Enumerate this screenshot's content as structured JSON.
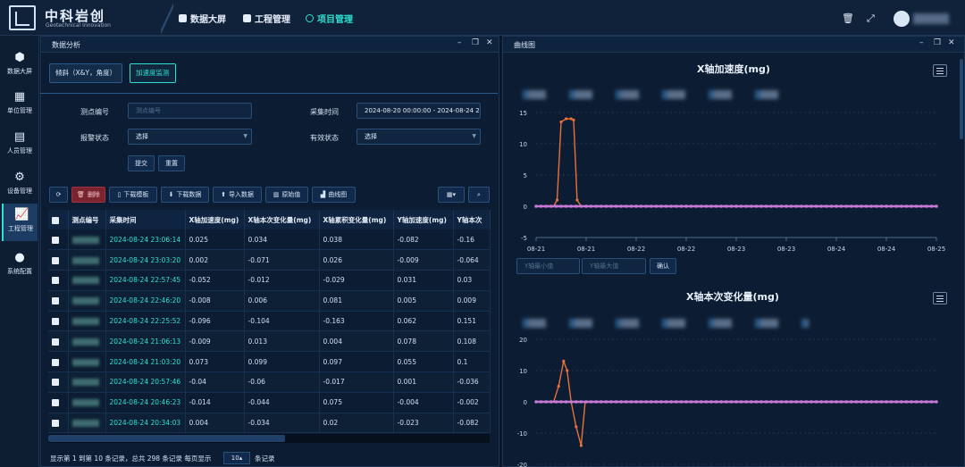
{
  "app": {
    "title": "中科岩创",
    "subtitle": "Geotechnical Innovation"
  },
  "top_nav": [
    {
      "label": "数据大屏",
      "icon": "cube-icon"
    },
    {
      "label": "工程管理",
      "icon": "edit-icon"
    },
    {
      "label": "项目管理",
      "icon": "circle-icon",
      "active": true
    }
  ],
  "top_icons": [
    "trash-icon",
    "fullscreen-icon"
  ],
  "sidebar": [
    {
      "label": "数据大屏",
      "icon": "cube-icon"
    },
    {
      "label": "单位管理",
      "icon": "calendar-icon"
    },
    {
      "label": "人员管理",
      "icon": "people-icon"
    },
    {
      "label": "设备管理",
      "icon": "gear-icon"
    },
    {
      "label": "工程管理",
      "icon": "chart-icon",
      "active": true
    },
    {
      "label": "系统配置",
      "icon": "chat-icon"
    }
  ],
  "left_panel": {
    "title": "数据分析",
    "tabs": [
      {
        "label": "倾斜（X&Y，角度）",
        "active": false
      },
      {
        "label": "加速度监测",
        "active": true
      }
    ],
    "filters": {
      "point_label": "测点编号",
      "point_placeholder": "测点编号",
      "time_label": "采集时间",
      "time_value": "2024-08-20 00:00:00 - 2024-08-24 2",
      "alarm_label": "报警状态",
      "alarm_value": "选择",
      "valid_label": "有效状态",
      "valid_value": "选择",
      "submit": "提交",
      "reset": "重置"
    },
    "toolbar": {
      "delete": "删除",
      "download_template": "下载模板",
      "download_data": "下载数据",
      "import_data": "导入数据",
      "raw_value": "原始值",
      "curve": "曲线图"
    },
    "table": {
      "headers": [
        "测点编号",
        "采集时间",
        "X轴加速度(mg)",
        "X轴本次变化量(mg)",
        "X轴累积变化量(mg)",
        "Y轴加速度(mg)",
        "Y轴本次"
      ],
      "rows": [
        [
          "2024-08-24 23:06:14",
          "0.025",
          "0.034",
          "0.038",
          "-0.082",
          "-0.16"
        ],
        [
          "2024-08-24 23:03:20",
          "0.002",
          "-0.071",
          "0.026",
          "-0.009",
          "-0.064"
        ],
        [
          "2024-08-24 22:57:45",
          "-0.052",
          "-0.012",
          "-0.029",
          "0.031",
          "0.03"
        ],
        [
          "2024-08-24 22:46:20",
          "-0.008",
          "0.006",
          "0.081",
          "0.005",
          "0.009"
        ],
        [
          "2024-08-24 22:25:52",
          "-0.096",
          "-0.104",
          "-0.163",
          "0.062",
          "0.151"
        ],
        [
          "2024-08-24 21:06:13",
          "-0.009",
          "0.013",
          "0.004",
          "0.078",
          "0.108"
        ],
        [
          "2024-08-24 21:03:20",
          "0.073",
          "0.099",
          "0.097",
          "0.055",
          "0.1"
        ],
        [
          "2024-08-24 20:57:46",
          "-0.04",
          "-0.06",
          "-0.017",
          "0.001",
          "-0.036"
        ],
        [
          "2024-08-24 20:46:23",
          "-0.014",
          "-0.044",
          "0.075",
          "-0.004",
          "-0.002"
        ],
        [
          "2024-08-24 20:34:03",
          "0.004",
          "-0.034",
          "0.02",
          "-0.023",
          "-0.082"
        ]
      ]
    },
    "pager": {
      "summary": "显示第 1 到第 10 条记录，总共 298 条记录 每页显示",
      "size": "10▴",
      "suffix": "条记录"
    }
  },
  "right_panel": {
    "title": "曲线图",
    "charts": [
      {
        "title": "X轴加速度(mg)",
        "y_ticks": [
          "15",
          "10",
          "5",
          "0",
          "-5"
        ],
        "x_ticks": [
          "08-21",
          "08-21",
          "08-22",
          "08-22",
          "08-23",
          "08-23",
          "08-24",
          "08-24",
          "08-25"
        ]
      },
      {
        "title": "X轴本次变化量(mg)",
        "y_ticks": [
          "20",
          "10",
          "0",
          "-10",
          "-20"
        ]
      }
    ],
    "range": {
      "min_placeholder": "Y轴最小值",
      "max_placeholder": "Y轴最大值",
      "confirm": "确认"
    }
  },
  "chart_data": [
    {
      "type": "line",
      "title": "X轴加速度(mg)",
      "ylim": [
        -5,
        15
      ],
      "x": [
        "08-21",
        "08-21",
        "08-22",
        "08-22",
        "08-23",
        "08-23",
        "08-24",
        "08-24",
        "08-25"
      ],
      "series": [
        {
          "color": "#e8703a",
          "values_note": "spike",
          "points": [
            [
              0,
              0
            ],
            [
              0.35,
              0
            ],
            [
              0.42,
              1
            ],
            [
              0.5,
              13.5
            ],
            [
              0.6,
              14
            ],
            [
              0.7,
              14
            ],
            [
              0.75,
              13.8
            ],
            [
              0.82,
              1
            ],
            [
              0.9,
              0
            ],
            [
              8,
              0
            ]
          ]
        },
        {
          "color": "#c67ad6",
          "points": [
            [
              0,
              0
            ],
            [
              8,
              0
            ]
          ]
        }
      ]
    },
    {
      "type": "line",
      "title": "X轴本次变化量(mg)",
      "ylim": [
        -20,
        20
      ],
      "series": [
        {
          "color": "#e8703a",
          "points": [
            [
              0,
              0
            ],
            [
              0.35,
              0
            ],
            [
              0.45,
              5
            ],
            [
              0.55,
              13
            ],
            [
              0.62,
              10
            ],
            [
              0.7,
              0
            ],
            [
              0.8,
              -8
            ],
            [
              0.9,
              -14
            ],
            [
              0.98,
              0
            ],
            [
              8,
              0
            ]
          ]
        },
        {
          "color": "#c67ad6",
          "points": [
            [
              0,
              0
            ],
            [
              8,
              0
            ]
          ]
        }
      ]
    }
  ]
}
